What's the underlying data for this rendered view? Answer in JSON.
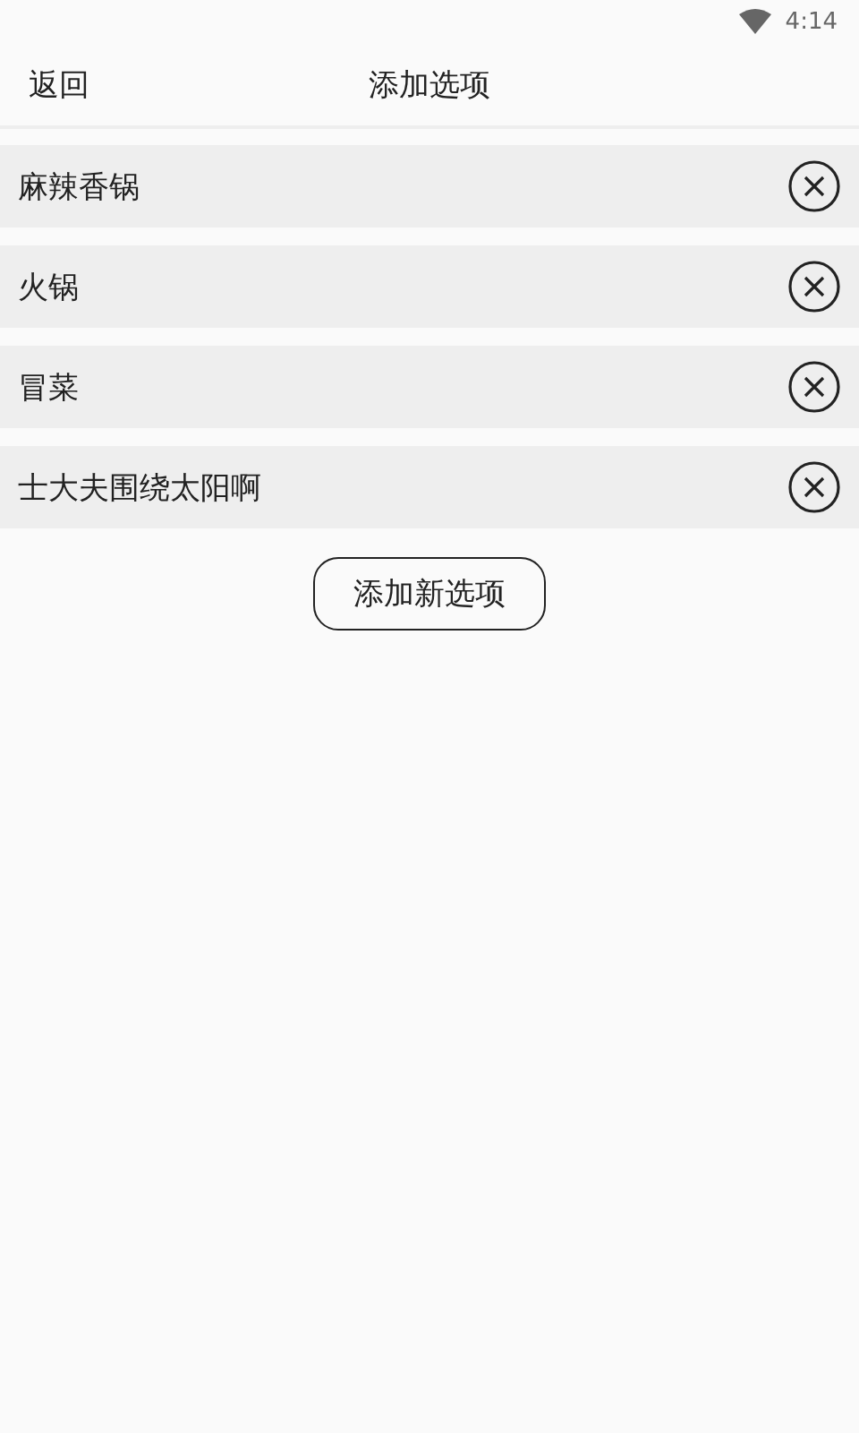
{
  "status_bar": {
    "time": "4:14"
  },
  "header": {
    "back": "返回",
    "title": "添加选项"
  },
  "options": [
    {
      "label": "麻辣香锅"
    },
    {
      "label": "火锅"
    },
    {
      "label": "冒菜"
    },
    {
      "label": "士大夫围绕太阳啊"
    }
  ],
  "add_button": "添加新选项"
}
